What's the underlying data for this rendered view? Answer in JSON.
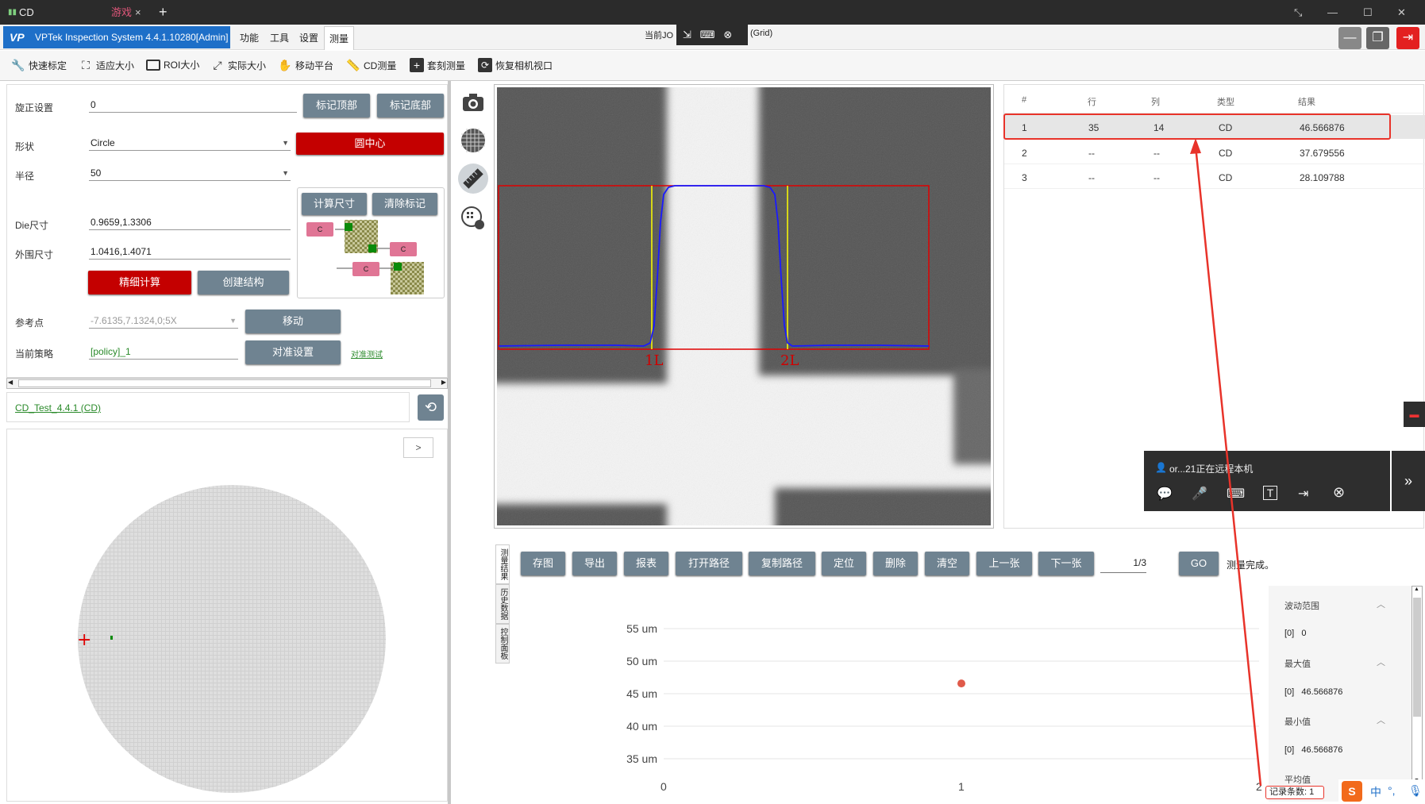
{
  "remote_bar": {
    "tab1": "CD",
    "tab2": "游戏",
    "close": "×",
    "new_tab": "+"
  },
  "app": {
    "title": "VPTek Inspection System 4.4.1.10280[Admin]",
    "menus": [
      "功能",
      "工具",
      "设置",
      "测量"
    ],
    "center_text_left": "当前JO",
    "center_text_right": "(Grid)"
  },
  "toolbar": [
    "快速标定",
    "适应大小",
    "ROI大小",
    "实际大小",
    "移动平台",
    "CD测量",
    "套刻测量",
    "恢复相机视口"
  ],
  "left_panel": {
    "rotate_label": "旋正设置",
    "rotate_value": "0",
    "mark_top": "标记顶部",
    "mark_bottom": "标记底部",
    "shape_label": "形状",
    "shape_value": "Circle",
    "circle_center": "圆中心",
    "radius_label": "半径",
    "radius_value": "50",
    "calc_size": "计算尺寸",
    "clear_mark": "清除标记",
    "die_label": "Die尺寸",
    "die_value": "0.9659,1.3306",
    "outer_label": "外围尺寸",
    "outer_value": "1.0416,1.4071",
    "fine_calc": "精细计算",
    "create_struct": "创建结构",
    "ref_label": "参考点",
    "ref_value": "-7.6135,7.1324,0;5X",
    "move": "移动",
    "policy_label": "当前策略",
    "policy_value": "[policy]_1",
    "align_set": "对准设置",
    "align_test": "对准测试",
    "recipe_link": "CD_Test_4.4.1 (CD)",
    "expand": ">",
    "struct_tags": [
      "C",
      "C",
      "C"
    ]
  },
  "overlay": {
    "label_1L": "1L",
    "label_2L": "2L"
  },
  "results_table": {
    "headers": [
      "#",
      "行",
      "列",
      "类型",
      "结果"
    ],
    "rows": [
      [
        "1",
        "35",
        "14",
        "CD",
        "46.566876"
      ],
      [
        "2",
        "--",
        "--",
        "CD",
        "37.679556"
      ],
      [
        "3",
        "--",
        "--",
        "CD",
        "28.109788"
      ]
    ]
  },
  "remote_popup": {
    "text": "or...21正在远程本机"
  },
  "bottom": {
    "vertical_tabs": [
      "测量结果",
      "历史数据",
      "控制面板"
    ],
    "buttons": [
      "存图",
      "导出",
      "报表",
      "打开路径",
      "复制路径",
      "定位",
      "删除",
      "清空",
      "上一张",
      "下一张"
    ],
    "page": "1/3",
    "go": "GO",
    "status": "测量完成。"
  },
  "chart_data": {
    "type": "scatter",
    "title": "",
    "xlabel": "",
    "ylabel": "",
    "x_ticks": [
      "0",
      "1",
      "2"
    ],
    "y_ticks": [
      "55 um",
      "50 um",
      "45 um",
      "40 um",
      "35 um"
    ],
    "xlim": [
      0,
      2
    ],
    "ylim": [
      35,
      55
    ],
    "grid": "horizontal",
    "series": [
      {
        "x": [
          1
        ],
        "y": [
          46.566876
        ],
        "color": "#e05a4a"
      }
    ]
  },
  "stats": {
    "range_label": "波动范围",
    "range_value": "[0]   0",
    "max_label": "最大值",
    "max_value": "[0]   46.566876",
    "min_label": "最小值",
    "min_value": "[0]   46.566876",
    "avg_label": "平均值",
    "record_count": "记录条数: 1"
  },
  "colors": {
    "accent_blue": "#1e6fc8",
    "button_gray": "#6f8391",
    "button_red": "#c40000",
    "annotation_red": "#e8332a"
  }
}
